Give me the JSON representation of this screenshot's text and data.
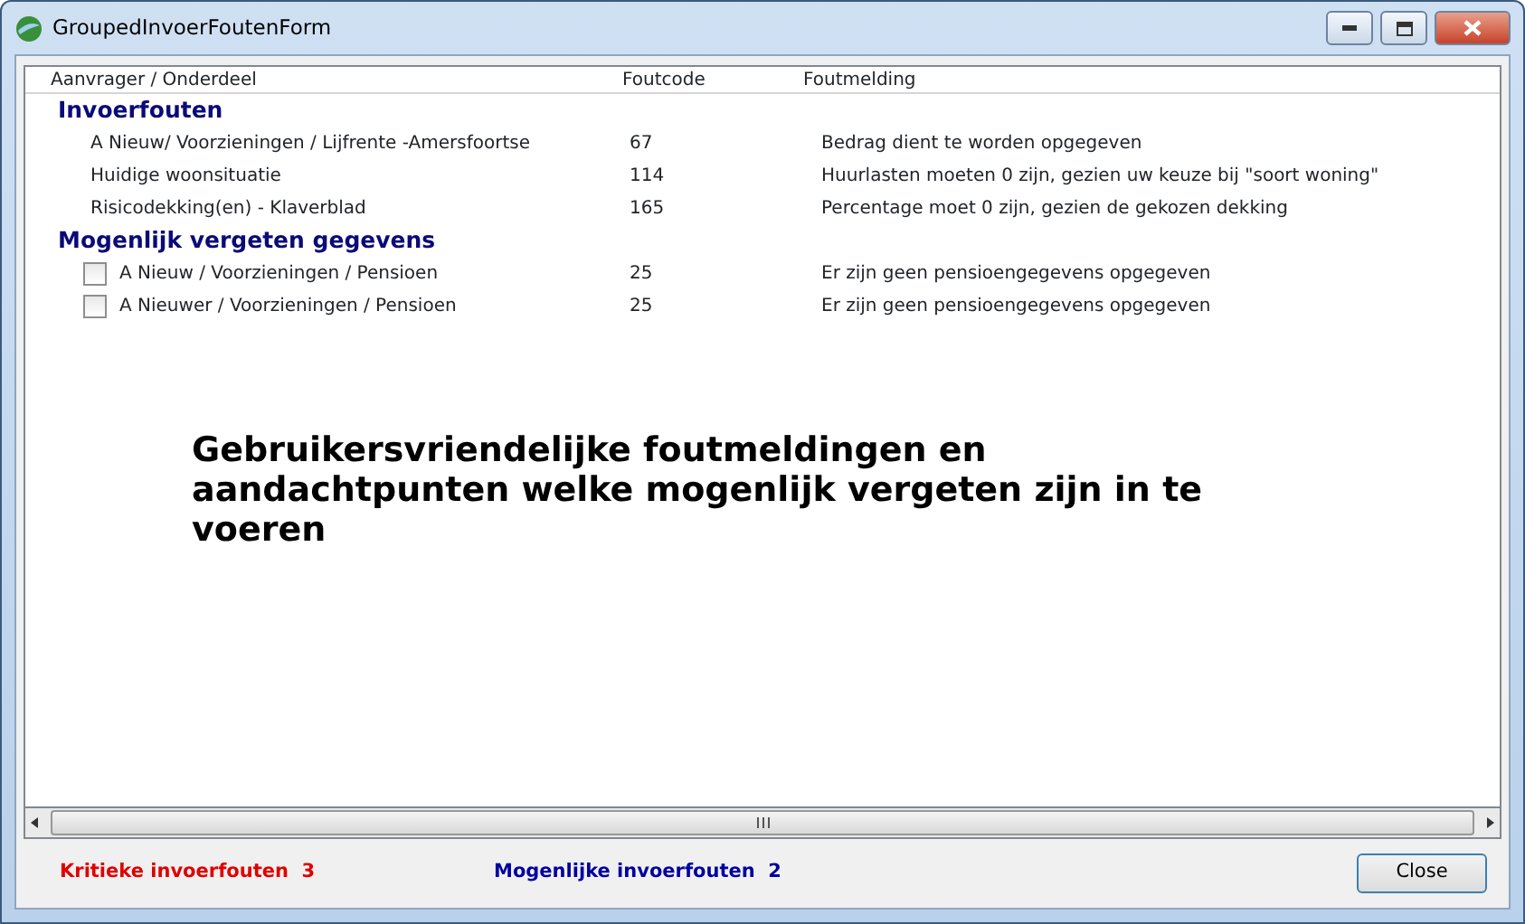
{
  "window": {
    "title": "GroupedInvoerFoutenForm"
  },
  "table": {
    "columns": [
      "Aanvrager / Onderdeel",
      "Foutcode",
      "Foutmelding"
    ],
    "groups": [
      {
        "title": "Invoerfouten",
        "rows": [
          {
            "kind": "text",
            "item": "A Nieuw/ Voorzieningen / Lijfrente -Amersfoortse",
            "code": "67",
            "message": "Bedrag dient te worden opgegeven"
          },
          {
            "kind": "text",
            "item": "Huidige woonsituatie",
            "code": "114",
            "message": "Huurlasten moeten 0 zijn, gezien uw keuze bij \"soort woning\""
          },
          {
            "kind": "text",
            "item": "Risicodekking(en) - Klaverblad",
            "code": "165",
            "message": "Percentage moet 0 zijn, gezien de gekozen dekking"
          }
        ]
      },
      {
        "title": "Mogenlijk vergeten gegevens",
        "rows": [
          {
            "kind": "checkbox",
            "checked": false,
            "item": "A Nieuw / Voorzieningen / Pensioen",
            "code": "25",
            "message": "Er zijn geen pensioengegevens opgegeven"
          },
          {
            "kind": "checkbox",
            "checked": false,
            "item": "A Nieuwer / Voorzieningen / Pensioen",
            "code": "25",
            "message": "Er zijn geen pensioengegevens opgegeven"
          }
        ]
      }
    ]
  },
  "note": "Gebruikersvriendelijke foutmeldingen en aandachtpunten welke mogenlijk vergeten zijn in te voeren",
  "status": [
    {
      "label": "Kritieke invoerfouten  3",
      "color": "#e00000"
    },
    {
      "label": "Mogenlijke invoerfouten  2",
      "color": "#0000a0"
    }
  ],
  "buttons": [
    "Close"
  ]
}
